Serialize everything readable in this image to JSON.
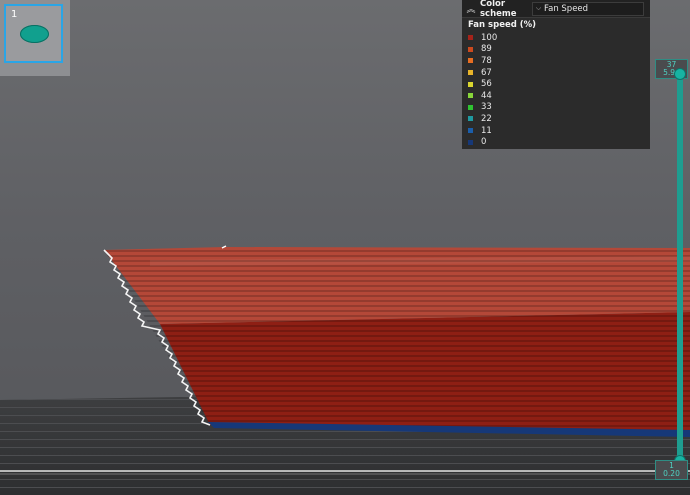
{
  "thumbnail": {
    "index": "1"
  },
  "legend": {
    "scheme_label": "Color scheme",
    "scheme_value": "Fan Speed",
    "title": "Fan speed (%)",
    "items": [
      {
        "value": "100",
        "color": "#a5231a"
      },
      {
        "value": "89",
        "color": "#cc4a1e"
      },
      {
        "value": "78",
        "color": "#e76e22"
      },
      {
        "value": "67",
        "color": "#e9b52a"
      },
      {
        "value": "56",
        "color": "#dad62f"
      },
      {
        "value": "44",
        "color": "#88d53a"
      },
      {
        "value": "33",
        "color": "#2fc331"
      },
      {
        "value": "22",
        "color": "#1f9aa1"
      },
      {
        "value": "11",
        "color": "#1b5eaa"
      },
      {
        "value": "0",
        "color": "#163878"
      }
    ]
  },
  "layer_slider": {
    "top_layer": "37",
    "top_height": "5.96",
    "bottom_layer": "1",
    "bottom_height": "0.20",
    "accent": "#17b3a2"
  },
  "model_colors": {
    "upper": "#b44838",
    "lower": "#8e1f14",
    "base": "#163878"
  }
}
